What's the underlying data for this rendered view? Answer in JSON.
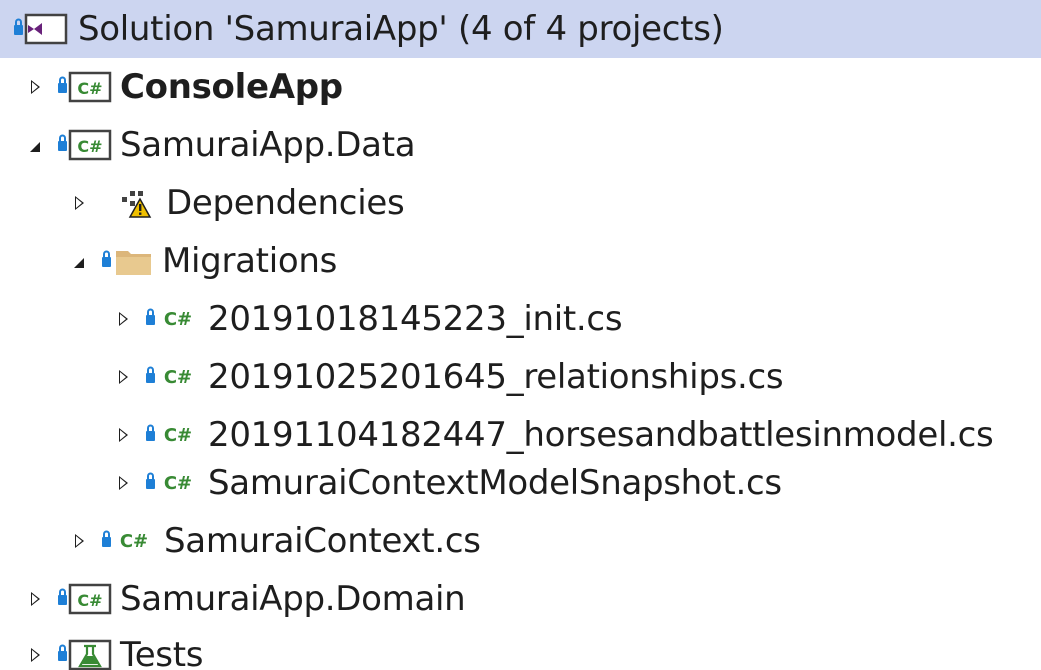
{
  "solution": {
    "label": "Solution 'SamuraiApp' (4 of 4 projects)"
  },
  "projects": {
    "console_app": "ConsoleApp",
    "data": "SamuraiApp.Data",
    "domain": "SamuraiApp.Domain",
    "tests": "Tests"
  },
  "data_children": {
    "dependencies": "Dependencies",
    "migrations": "Migrations",
    "context_file": "SamuraiContext.cs"
  },
  "migration_files": [
    "20191018145223_init.cs",
    "20191025201645_relationships.cs",
    "20191104182447_horsesandbattlesinmodel.cs",
    "SamuraiContextModelSnapshot.cs"
  ],
  "icons": {
    "csharp_label": "C#",
    "csharp_project_label": "C#"
  },
  "colors": {
    "selection": "#ccd5f0",
    "csharp_green": "#388a34",
    "lock_blue": "#1e7fd6",
    "folder_tan": "#dcb67a",
    "vs_purple": "#68217a",
    "warning_yellow": "#f0c000"
  }
}
